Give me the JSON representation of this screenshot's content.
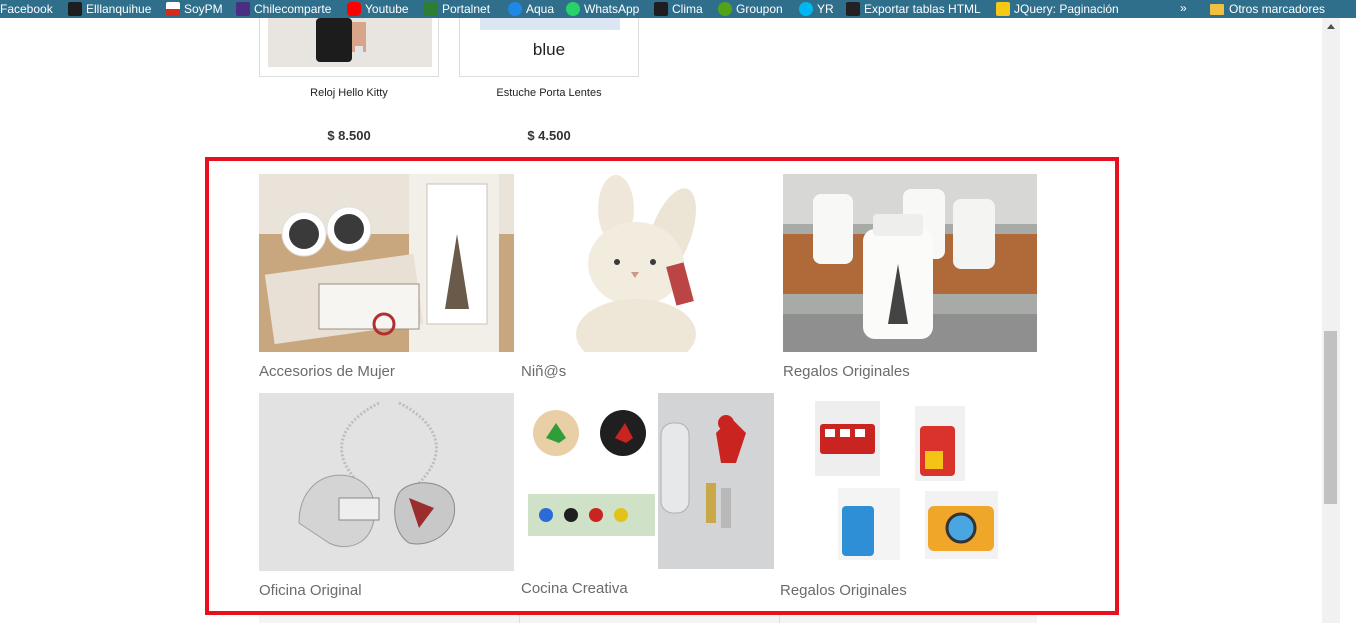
{
  "bookmarks": {
    "items": [
      {
        "label": "Facebook",
        "icon": "facebook-icon",
        "color": "#3b5998"
      },
      {
        "label": "Elllanquihue",
        "icon": "site-icon",
        "color": "#555555"
      },
      {
        "label": "SoyPM",
        "icon": "chile-flag-icon",
        "color": "#d52b1e"
      },
      {
        "label": "Chilecomparte",
        "icon": "site-icon",
        "color": "#4b2e83"
      },
      {
        "label": "Youtube",
        "icon": "youtube-icon",
        "color": "#ff0000"
      },
      {
        "label": "Portalnet",
        "icon": "site-icon",
        "color": "#2e7d32"
      },
      {
        "label": "Aqua",
        "icon": "site-icon",
        "color": "#1e88e5"
      },
      {
        "label": "WhatsApp",
        "icon": "whatsapp-icon",
        "color": "#25d366"
      },
      {
        "label": "Clima",
        "icon": "site-icon",
        "color": "#555555"
      },
      {
        "label": "Groupon",
        "icon": "groupon-icon",
        "color": "#53a318"
      },
      {
        "label": "YR",
        "icon": "yr-icon",
        "color": "#00b8f1"
      },
      {
        "label": "Exportar tablas HTML",
        "icon": "site-icon",
        "color": "#333333"
      },
      {
        "label": "JQuery: Paginación",
        "icon": "site-icon",
        "color": "#f6c915"
      }
    ],
    "more": "»",
    "folder_label": "Otros marcadores"
  },
  "products": [
    {
      "name": "Reloj Hello Kitty",
      "price": "$ 8.500"
    },
    {
      "name": "Estuche Porta Lentes",
      "price": "$ 4.500",
      "image_text": "blue"
    }
  ],
  "categories": [
    {
      "label": "Accesorios de Mujer"
    },
    {
      "label": "Niñ@s"
    },
    {
      "label": "Regalos Originales"
    },
    {
      "label": "Oficina Original"
    },
    {
      "label": "Cocina Creativa"
    },
    {
      "label": "Regalos Originales"
    }
  ],
  "colors": {
    "highlight": "#e8101c",
    "bookmarks_bar": "#2f6f8c",
    "label": "#6b6b6b"
  }
}
